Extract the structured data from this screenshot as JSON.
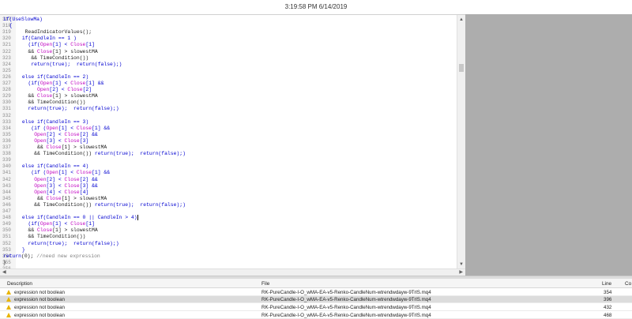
{
  "clock": "3:19:58 PM 6/14/2019",
  "code": [
    {
      "ln": "317",
      "full": true,
      "parts": [
        [
          "k",
          "if(UseSlowMa)"
        ]
      ]
    },
    {
      "ln": "318",
      "full": true,
      "parts": [
        [
          "k",
          "  {"
        ]
      ]
    },
    {
      "ln": "319",
      "parts": [
        [
          "n",
          "  ReadIndicatorValues();"
        ]
      ]
    },
    {
      "ln": "320",
      "parts": [
        [
          "k",
          " if(CandleIn == 1 )"
        ]
      ]
    },
    {
      "ln": "321",
      "parts": [
        [
          "k",
          "   (if("
        ],
        [
          "p",
          "Open"
        ],
        [
          "k",
          "[1] < "
        ],
        [
          "p",
          "Close"
        ],
        [
          "k",
          "[1]"
        ]
      ]
    },
    {
      "ln": "322",
      "parts": [
        [
          "n",
          "   && "
        ],
        [
          "p",
          "Close"
        ],
        [
          "n",
          "[1] > slowestMA"
        ]
      ]
    },
    {
      "ln": "323",
      "parts": [
        [
          "n",
          "    && TimeCondition())"
        ]
      ]
    },
    {
      "ln": "324",
      "parts": [
        [
          "k",
          "    return(true);  return(false);)"
        ]
      ]
    },
    {
      "ln": "325",
      "parts": []
    },
    {
      "ln": "326",
      "parts": [
        [
          "k",
          " else if(CandleIn == 2)"
        ]
      ]
    },
    {
      "ln": "327",
      "parts": [
        [
          "k",
          "   (if("
        ],
        [
          "p",
          "Open"
        ],
        [
          "k",
          "[1] < "
        ],
        [
          "p",
          "Close"
        ],
        [
          "k",
          "[1] &&"
        ]
      ]
    },
    {
      "ln": "328",
      "parts": [
        [
          "n",
          "      "
        ],
        [
          "p",
          "Open"
        ],
        [
          "k",
          "[2] < "
        ],
        [
          "p",
          "Close"
        ],
        [
          "k",
          "[2]"
        ]
      ]
    },
    {
      "ln": "329",
      "parts": [
        [
          "n",
          "   && "
        ],
        [
          "p",
          "Close"
        ],
        [
          "n",
          "[1] > slowestMA"
        ]
      ]
    },
    {
      "ln": "330",
      "parts": [
        [
          "n",
          "   && TimeCondition())"
        ]
      ]
    },
    {
      "ln": "331",
      "parts": [
        [
          "k",
          "   return(true);  return(false);)"
        ]
      ]
    },
    {
      "ln": "332",
      "parts": []
    },
    {
      "ln": "333",
      "parts": [
        [
          "k",
          " else if(CandleIn == 3)"
        ]
      ]
    },
    {
      "ln": "334",
      "parts": [
        [
          "k",
          "    (if ("
        ],
        [
          "p",
          "Open"
        ],
        [
          "k",
          "[1] < "
        ],
        [
          "p",
          "Close"
        ],
        [
          "k",
          "[1] &&"
        ]
      ]
    },
    {
      "ln": "335",
      "parts": [
        [
          "n",
          "     "
        ],
        [
          "p",
          "Open"
        ],
        [
          "k",
          "[2] < "
        ],
        [
          "p",
          "Close"
        ],
        [
          "k",
          "[2] &&"
        ]
      ]
    },
    {
      "ln": "336",
      "parts": [
        [
          "n",
          "     "
        ],
        [
          "p",
          "Open"
        ],
        [
          "k",
          "[3] < "
        ],
        [
          "p",
          "Close"
        ],
        [
          "k",
          "[3]"
        ]
      ]
    },
    {
      "ln": "337",
      "parts": [
        [
          "n",
          "      && "
        ],
        [
          "p",
          "Close"
        ],
        [
          "n",
          "[1] > slowestMA"
        ]
      ]
    },
    {
      "ln": "338",
      "parts": [
        [
          "n",
          "     && TimeCondition()) "
        ],
        [
          "k",
          "return(true);  return(false);)"
        ]
      ]
    },
    {
      "ln": "339",
      "parts": []
    },
    {
      "ln": "340",
      "parts": [
        [
          "k",
          " else if(CandleIn == 4)"
        ]
      ]
    },
    {
      "ln": "341",
      "parts": [
        [
          "k",
          "    (if ("
        ],
        [
          "p",
          "Open"
        ],
        [
          "k",
          "[1] < "
        ],
        [
          "p",
          "Close"
        ],
        [
          "k",
          "[1] &&"
        ]
      ]
    },
    {
      "ln": "342",
      "parts": [
        [
          "n",
          "     "
        ],
        [
          "p",
          "Open"
        ],
        [
          "k",
          "[2] < "
        ],
        [
          "p",
          "Close"
        ],
        [
          "k",
          "[2] &&"
        ]
      ]
    },
    {
      "ln": "343",
      "parts": [
        [
          "n",
          "     "
        ],
        [
          "p",
          "Open"
        ],
        [
          "k",
          "[3] < "
        ],
        [
          "p",
          "Close"
        ],
        [
          "k",
          "[3] &&"
        ]
      ]
    },
    {
      "ln": "344",
      "parts": [
        [
          "n",
          "     "
        ],
        [
          "p",
          "Open"
        ],
        [
          "k",
          "[4] < "
        ],
        [
          "p",
          "Close"
        ],
        [
          "k",
          "[4]"
        ]
      ]
    },
    {
      "ln": "345",
      "parts": [
        [
          "n",
          "      && "
        ],
        [
          "p",
          "Close"
        ],
        [
          "n",
          "[1] > slowestMA"
        ]
      ]
    },
    {
      "ln": "346",
      "parts": [
        [
          "n",
          "     && TimeCondition()) "
        ],
        [
          "k",
          "return(true);  return(false);)"
        ]
      ]
    },
    {
      "ln": "347",
      "parts": []
    },
    {
      "ln": "348",
      "parts": [
        [
          "k",
          " else if(CandleIn == 0 || CandleIn > 4)"
        ],
        [
          "caret",
          ""
        ]
      ]
    },
    {
      "ln": "349",
      "parts": [
        [
          "k",
          "   (if("
        ],
        [
          "p",
          "Open"
        ],
        [
          "k",
          "[1] < "
        ],
        [
          "p",
          "Close"
        ],
        [
          "k",
          "[1]"
        ]
      ]
    },
    {
      "ln": "350",
      "parts": [
        [
          "n",
          "   && "
        ],
        [
          "p",
          "Close"
        ],
        [
          "n",
          "[1] > slowestMA"
        ]
      ]
    },
    {
      "ln": "351",
      "parts": [
        [
          "n",
          "   && TimeCondition())"
        ]
      ]
    },
    {
      "ln": "352",
      "parts": [
        [
          "k",
          "   return(true);  return(false);)"
        ]
      ]
    },
    {
      "ln": "353",
      "parts": [
        [
          "k",
          " }"
        ]
      ]
    },
    {
      "ln": "354",
      "full": true,
      "parts": [
        [
          "k",
          "return"
        ],
        [
          "n",
          "(0); "
        ],
        [
          "c",
          "//need new expression"
        ]
      ]
    },
    {
      "ln": "355",
      "full": true,
      "parts": [
        [
          "n",
          "}"
        ]
      ]
    },
    {
      "ln": "356",
      "parts": []
    }
  ],
  "errors": {
    "headers": {
      "description": "Description",
      "file": "File",
      "line": "Line",
      "column": "Co"
    },
    "rows": [
      {
        "description": "expression not boolean",
        "file": "RK-PureCandle-I-O_wMA-EA-v5-Renko-CandleNum-wtrendwdayw-9TrlS.mq4",
        "line": "354",
        "selected": false
      },
      {
        "description": "expression not boolean",
        "file": "RK-PureCandle-I-O_wMA-EA-v5-Renko-CandleNum-wtrendwdayw-9TrlS.mq4",
        "line": "396",
        "selected": true
      },
      {
        "description": "expression not boolean",
        "file": "RK-PureCandle-I-O_wMA-EA-v5-Renko-CandleNum-wtrendwdayw-9TrlS.mq4",
        "line": "432",
        "selected": false
      },
      {
        "description": "expression not boolean",
        "file": "RK-PureCandle-I-O_wMA-EA-v5-Renko-CandleNum-wtrendwdayw-9TrlS.mq4",
        "line": "468",
        "selected": false
      }
    ]
  },
  "colors": {
    "keyword": "#0000d0",
    "price": "#c000c0",
    "warning": "#e8b400"
  },
  "icons": {
    "warning": "warning-icon",
    "scroll_up": "arrow-up-icon",
    "scroll_down": "arrow-down-icon"
  }
}
